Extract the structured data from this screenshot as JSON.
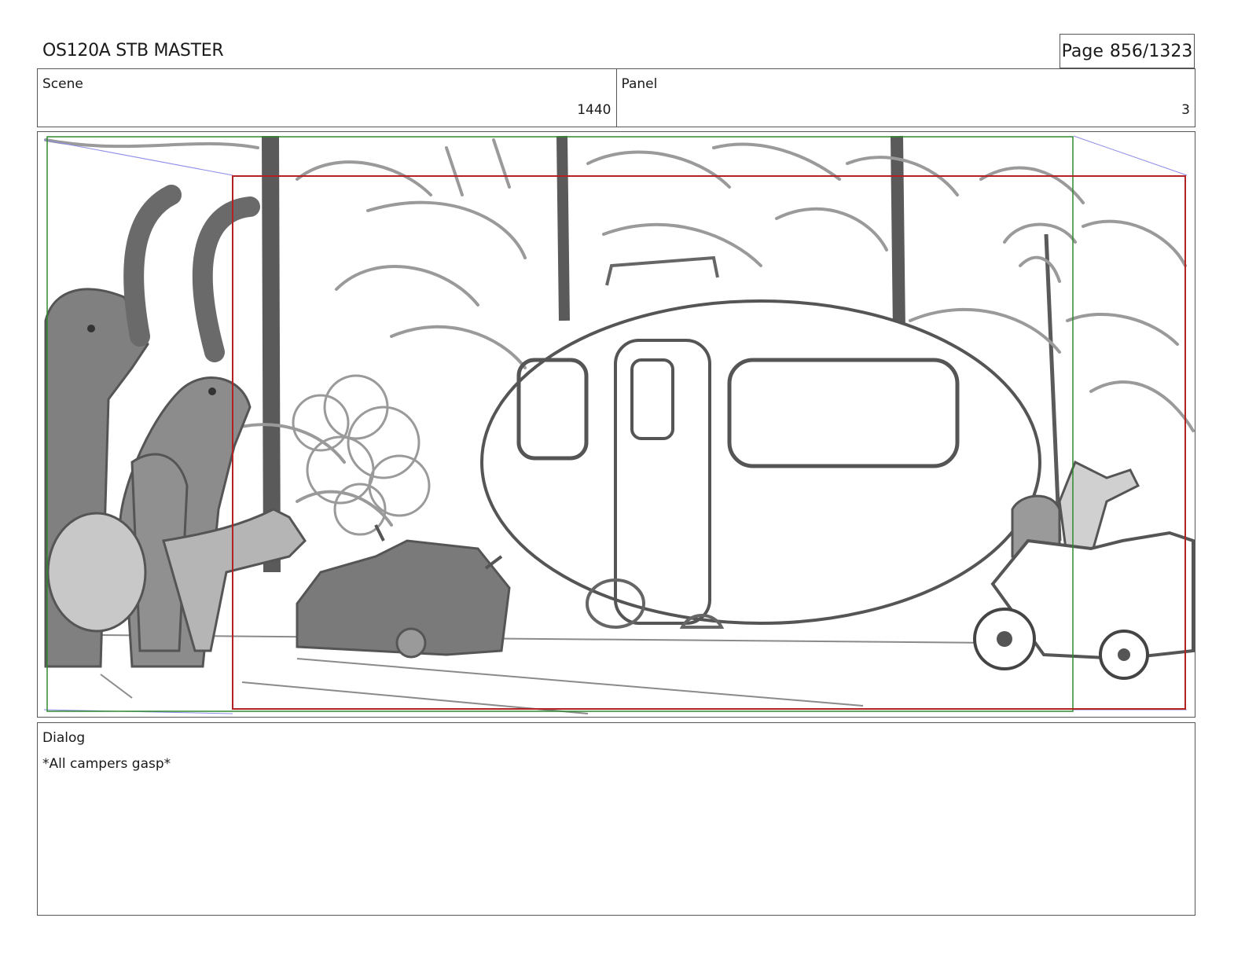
{
  "header": {
    "title": "OS120A STB MASTER",
    "page_label": "Page",
    "page_number": "856/1323"
  },
  "info": {
    "scene_label": "Scene",
    "scene_value": "1440",
    "panel_label": "Panel",
    "panel_value": "3"
  },
  "panel_image": {
    "description_icon": "storyboard-sketch",
    "safe_frame_color": "#2e8b2e",
    "action_frame_color": "#b22222",
    "camera_path_color": "#8a8ae8"
  },
  "dialog": {
    "label": "Dialog",
    "text": "*All campers gasp*"
  }
}
